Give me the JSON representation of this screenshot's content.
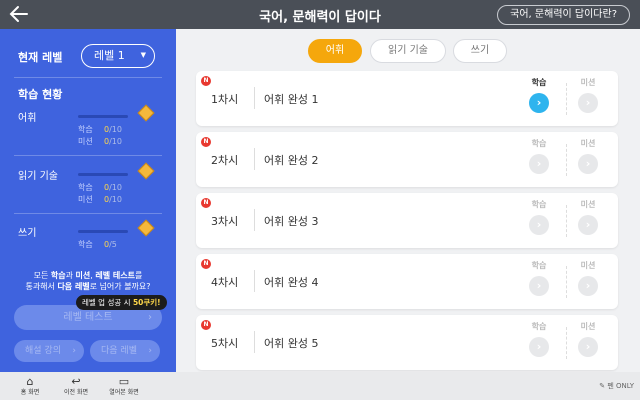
{
  "header": {
    "back_icon": "back-arrow-icon",
    "title": "국어, 문해력이 답이다",
    "help_button": "국어, 문해력이 답이다란?"
  },
  "sidebar": {
    "level_label": "현재 레벨",
    "level_value": "레벨 1",
    "progress_title": "학습 현황",
    "subjects": [
      {
        "name": "어휘",
        "study_label": "학습",
        "study_done": "0",
        "study_total": "/10",
        "mission_label": "미션",
        "mission_done": "0",
        "mission_total": "/10"
      },
      {
        "name": "읽기 기술",
        "study_label": "학습",
        "study_done": "0",
        "study_total": "/10",
        "mission_label": "미션",
        "mission_done": "0",
        "mission_total": "/10"
      },
      {
        "name": "쓰기",
        "study_label": "학습",
        "study_done": "0",
        "study_total": "/5"
      }
    ],
    "notice_line1_a": "모든 ",
    "notice_line1_b": "학습",
    "notice_line1_c": "과 ",
    "notice_line1_d": "미션",
    "notice_line1_e": ", ",
    "notice_line1_f": "레벨 테스트",
    "notice_line1_g": "를",
    "notice_line2_a": "통과해서 ",
    "notice_line2_b": "다음 레벨",
    "notice_line2_c": "로 넘어가 볼까요?",
    "badge_text": "레벨 업 성공 시 ",
    "badge_highlight": "50쿠키!",
    "level_test_button": "레벨 테스트",
    "commentary_button": "해설 강의",
    "next_level_button": "다음 레벨"
  },
  "tabs": [
    {
      "label": "어휘",
      "active": true
    },
    {
      "label": "읽기 기술",
      "active": false
    },
    {
      "label": "쓰기",
      "active": false
    }
  ],
  "lessons": [
    {
      "badge": "N",
      "session": "1차시",
      "title": "어휘 완성 1",
      "study_label": "학습",
      "mission_label": "미션",
      "study_enabled": true
    },
    {
      "badge": "N",
      "session": "2차시",
      "title": "어휘 완성 2",
      "study_label": "학습",
      "mission_label": "미션",
      "study_enabled": false
    },
    {
      "badge": "N",
      "session": "3차시",
      "title": "어휘 완성 3",
      "study_label": "학습",
      "mission_label": "미션",
      "study_enabled": false
    },
    {
      "badge": "N",
      "session": "4차시",
      "title": "어휘 완성 4",
      "study_label": "학습",
      "mission_label": "미션",
      "study_enabled": false
    },
    {
      "badge": "N",
      "session": "5차시",
      "title": "어휘 완성 5",
      "study_label": "학습",
      "mission_label": "미션",
      "study_enabled": false
    }
  ],
  "navbar": {
    "home_label_1": "홈",
    "home_label_2": "화면",
    "prev_label_1": "이전",
    "prev_label_2": "화면",
    "apps_label_1": "열어본",
    "apps_label_2": "화면",
    "pen_only": "펜 ONLY"
  },
  "colors": {
    "accent_blue": "#3f63de",
    "tab_active": "#f5a70c",
    "go_active": "#2eb4ee",
    "new_badge": "#e8382f"
  }
}
